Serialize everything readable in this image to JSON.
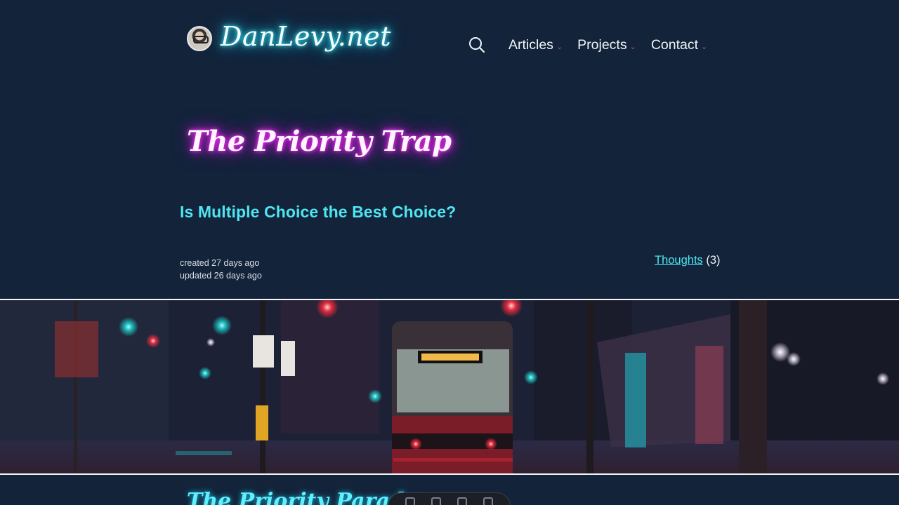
{
  "site": {
    "brand": "DanLevy.net",
    "nav": [
      {
        "label": "Articles"
      },
      {
        "label": "Projects"
      },
      {
        "label": "Contact"
      }
    ]
  },
  "post": {
    "title": "The Priority Trap",
    "subtitle": "Is Multiple Choice the Best Choice?",
    "created": "created 27 days ago",
    "updated": "updated 26 days ago",
    "category": "Thoughts",
    "category_count": "(3)"
  },
  "next_section": {
    "heading": "The Priority Paradox"
  },
  "colors": {
    "background": "#12233a",
    "accent_cyan": "#4fe6f2",
    "accent_magenta": "#d32fd8"
  },
  "icons": {
    "search": "search-icon",
    "caret": "chevron-down-icon"
  }
}
